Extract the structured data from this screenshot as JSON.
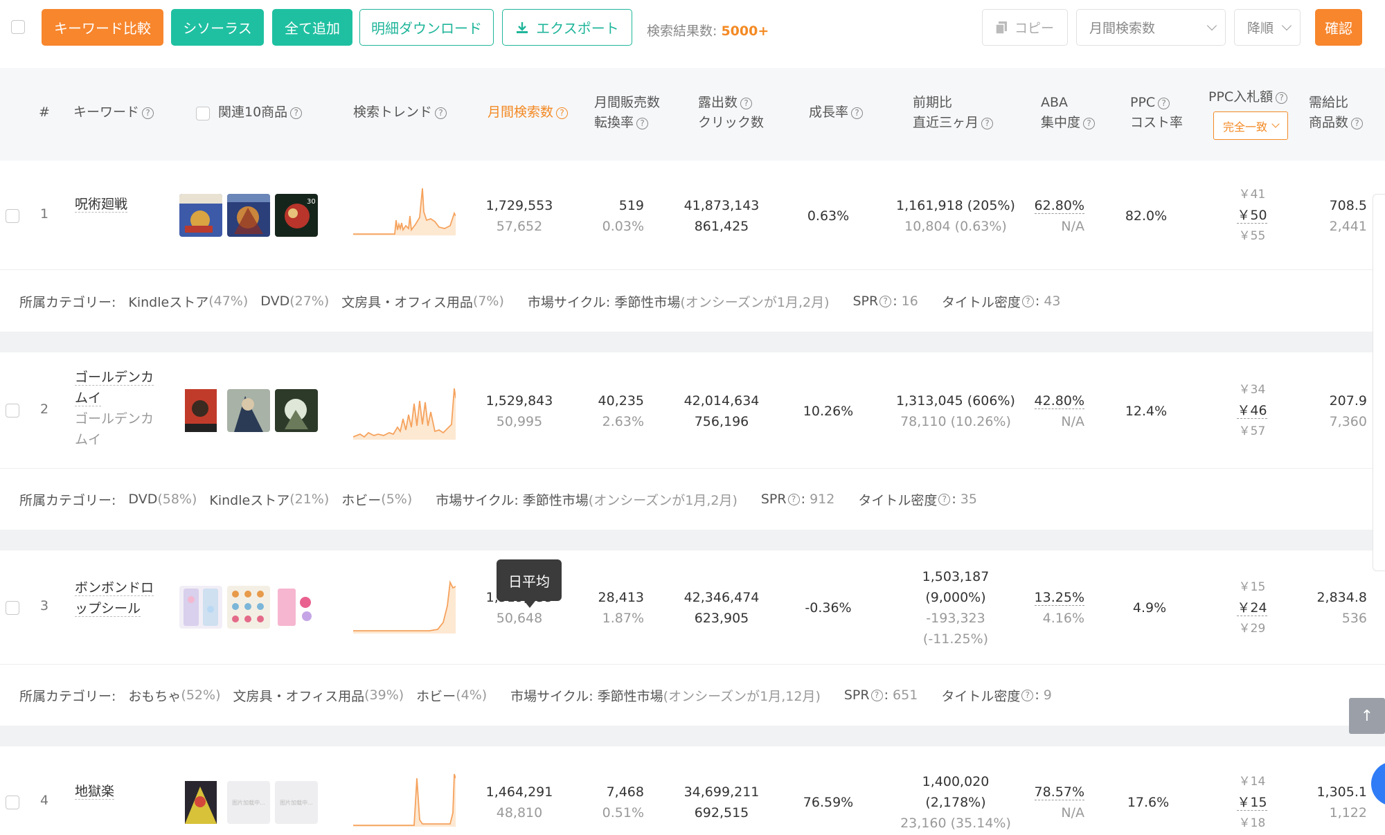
{
  "toolbar": {
    "keyword_compare": "キーワード比較",
    "thesaurus": "シソーラス",
    "add_all": "全て追加",
    "detail_download": "明細ダウンロード",
    "export": "エクスポート",
    "result_label": "検索結果数:",
    "result_count": "5000+",
    "copy": "コピー",
    "sort_field": "月間検索数",
    "sort_order": "降順",
    "confirm": "確認"
  },
  "header": {
    "index": "#",
    "keyword": "キーワード",
    "related": "関連10商品",
    "trend": "検索トレンド",
    "monthly_search": "月間検索数",
    "monthly_sales_1": "月間販売数",
    "monthly_sales_2": "転換率",
    "exposure_1": "露出数",
    "exposure_2": "クリック数",
    "growth": "成長率",
    "prev_1": "前期比",
    "prev_2": "直近三ヶ月",
    "aba_1": "ABA",
    "aba_2": "集中度",
    "ppc_1": "PPC",
    "ppc_2": "コスト率",
    "bid": "PPC入札額",
    "bid_mode": "完全一致",
    "supply_1": "需給比",
    "supply_2": "商品数"
  },
  "rows": [
    {
      "index": "1",
      "keyword": "呪術廻戦",
      "sub": "",
      "search": "1,729,553",
      "search_daily": "57,652",
      "sales": "519",
      "conv": "0.03%",
      "exposure": "41,873,143",
      "clicks": "861,425",
      "growth": "0.63%",
      "prev": "1,161,918 (205%)",
      "prev_3m": "10,804 (0.63%)",
      "aba": "62.80%",
      "aba_sub": "N/A",
      "ppc": "82.0%",
      "bid_low": "￥41",
      "bid_mid": "￥50",
      "bid_high": "￥55",
      "supply": "708.5",
      "products": "2,441",
      "categories": {
        "label": "所属カテゴリー:",
        "c1": "Kindleストア",
        "p1": "(47%)",
        "c2": "DVD",
        "p2": "(27%)",
        "c3": "文房具・オフィス用品",
        "p3": "(7%)",
        "cycle_label": "市場サイクル:",
        "cycle": "季節性市場",
        "cycle_note": "(オンシーズンが1月,2月)",
        "spr_label": "SPR",
        "spr": "16",
        "density_label": "タイトル密度",
        "density": "43"
      }
    },
    {
      "index": "2",
      "keyword": "ゴールデンカムイ",
      "sub": "ゴールデンカムイ",
      "search": "1,529,843",
      "search_daily": "50,995",
      "sales": "40,235",
      "conv": "2.63%",
      "exposure": "42,014,634",
      "clicks": "756,196",
      "growth": "10.26%",
      "prev": "1,313,045 (606%)",
      "prev_3m": "78,110 (10.26%)",
      "aba": "42.80%",
      "aba_sub": "N/A",
      "ppc": "12.4%",
      "bid_low": "￥34",
      "bid_mid": "￥46",
      "bid_high": "￥57",
      "supply": "207.9",
      "products": "7,360",
      "categories": {
        "label": "所属カテゴリー:",
        "c1": "DVD",
        "p1": "(58%)",
        "c2": "Kindleストア",
        "p2": "(21%)",
        "c3": "ホビー",
        "p3": "(5%)",
        "cycle_label": "市場サイクル:",
        "cycle": "季節性市場",
        "cycle_note": "(オンシーズンが1月,2月)",
        "spr_label": "SPR",
        "spr": "912",
        "density_label": "タイトル密度",
        "density": "35"
      }
    },
    {
      "index": "3",
      "keyword": "ボンボンドロップシール",
      "sub": "",
      "search": "1,519,435",
      "search_daily": "50,648",
      "sales": "28,413",
      "conv": "1.87%",
      "exposure": "42,346,474",
      "clicks": "623,905",
      "growth": "-0.36%",
      "prev_a": "1,503,187",
      "prev_b": "(9,000%)",
      "prev_c": "-193,323",
      "prev_d": "(-11.25%)",
      "aba": "13.25%",
      "aba_sub": "4.16%",
      "ppc": "4.9%",
      "bid_low": "￥15",
      "bid_mid": "￥24",
      "bid_high": "￥29",
      "supply": "2,834.8",
      "products": "536",
      "categories": {
        "label": "所属カテゴリー:",
        "c1": "おもちゃ",
        "p1": "(52%)",
        "c2": "文房具・オフィス用品",
        "p2": "(39%)",
        "c3": "ホビー",
        "p3": "(4%)",
        "cycle_label": "市場サイクル:",
        "cycle": "季節性市場",
        "cycle_note": "(オンシーズンが1月,12月)",
        "spr_label": "SPR",
        "spr": "651",
        "density_label": "タイトル密度",
        "density": "9"
      }
    },
    {
      "index": "4",
      "keyword": "地獄楽",
      "sub": "",
      "search": "1,464,291",
      "search_daily": "48,810",
      "sales": "7,468",
      "conv": "0.51%",
      "exposure": "34,699,211",
      "clicks": "692,515",
      "growth": "76.59%",
      "prev_a": "1,400,020",
      "prev_b": "(2,178%)",
      "prev_c": "23,160 (35.14%)",
      "aba": "78.57%",
      "aba_sub": "N/A",
      "ppc": "17.6%",
      "bid_low": "￥14",
      "bid_mid": "￥15",
      "bid_high": "￥18",
      "supply": "1,305.1",
      "products": "1,122"
    }
  ],
  "tooltip": "日平均",
  "placeholder_thumb": "图片加载中...",
  "colors": {
    "accent_orange": "#f7862d",
    "accent_green": "#1fc0a1"
  }
}
